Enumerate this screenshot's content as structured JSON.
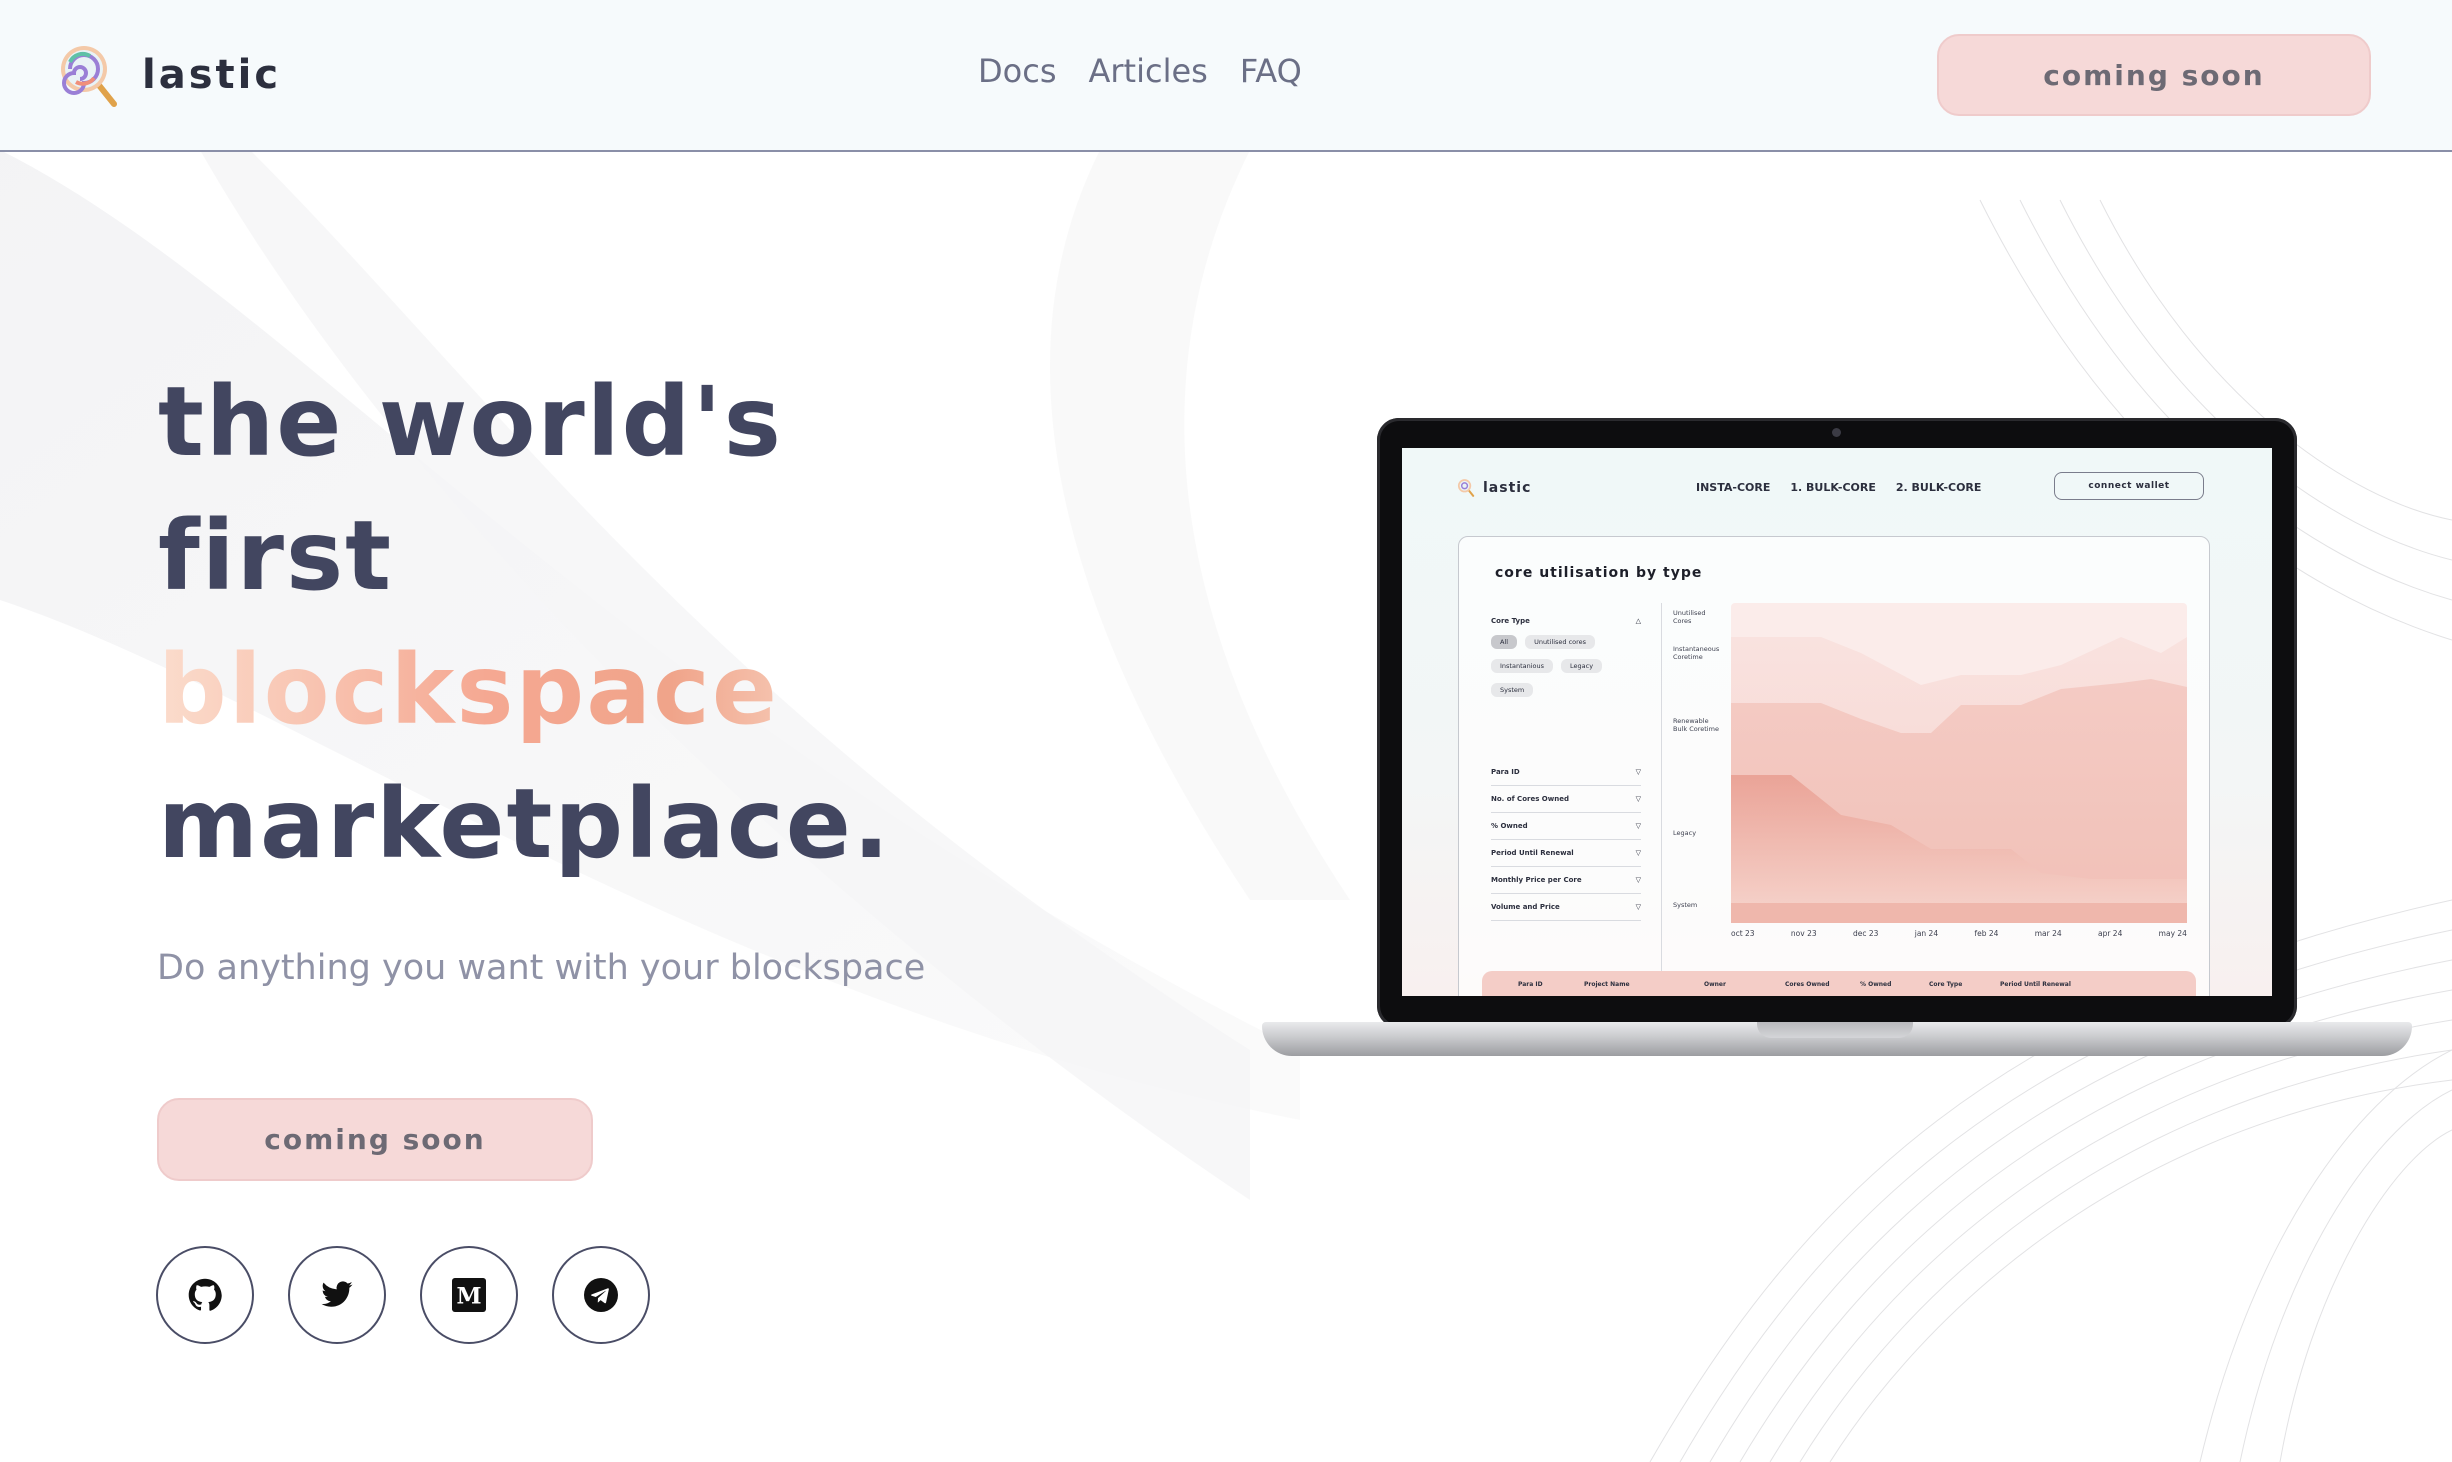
{
  "brand": {
    "name": "Lastic",
    "icon": "lollipop-magnifier-icon"
  },
  "nav": {
    "links": [
      "Docs",
      "Articles",
      "FAQ"
    ]
  },
  "header": {
    "cta_label": "coming soon"
  },
  "hero": {
    "title_lines": [
      "the world's",
      "first",
      "blockspace",
      "marketplace."
    ],
    "subtitle": "Do anything you want with your blockspace",
    "cta_label": "coming soon"
  },
  "socials": [
    {
      "name": "github",
      "icon": "github-icon"
    },
    {
      "name": "twitter",
      "icon": "twitter-icon"
    },
    {
      "name": "medium",
      "icon": "medium-icon"
    },
    {
      "name": "telegram",
      "icon": "telegram-icon"
    }
  ],
  "colors": {
    "accent_button_bg": "#f6d9d8",
    "title_text": "#424660",
    "accent_gradient": [
      "#fbdccc",
      "#f5a892",
      "#fbe2d3"
    ]
  },
  "mockup": {
    "brand": "Lastic",
    "nav": [
      "INSTA-CORE",
      "1. BULK-CORE",
      "2. BULK-CORE"
    ],
    "wallet_label": "connect wallet",
    "card_title": "core utilisation by type",
    "filter": {
      "heading": "Core Type",
      "chips": [
        "All",
        "Unutilised cores",
        "Instantanious",
        "Legacy",
        "System"
      ],
      "rows": [
        "Para ID",
        "No. of Cores Owned",
        "% Owned",
        "Period Until Renewal",
        "Monthly Price per Core",
        "Volume and Price"
      ]
    },
    "chart": {
      "type": "area",
      "y_labels": [
        "Unutilised Cores",
        "Instantaneous Coretime",
        "Renewable Bulk Coretime",
        "Legacy",
        "System"
      ],
      "x_labels": [
        "oct 23",
        "nov 23",
        "dec 23",
        "jan 24",
        "feb 24",
        "mar 24",
        "apr 24",
        "may 24"
      ]
    },
    "table_headers": [
      "Para ID",
      "Project Name",
      "Owner",
      "Cores Owned",
      "% Owned",
      "Core Type",
      "Period Until Renewal"
    ]
  }
}
